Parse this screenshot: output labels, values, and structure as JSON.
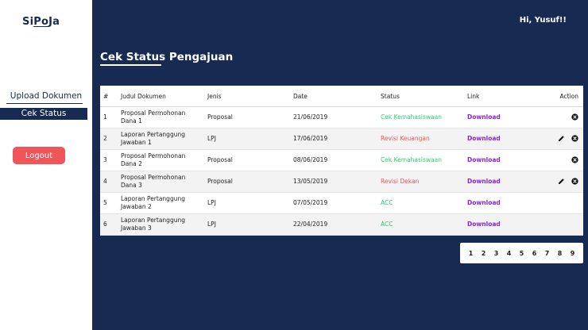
{
  "app": {
    "logo": "SiPoJa",
    "logo_underlined": "Po"
  },
  "sidebar": {
    "upload_label": "Upload Dokumen",
    "status_label": "Cek Status",
    "logout_label": "Logout"
  },
  "header": {
    "greeting": "Hi, Yusuf!!"
  },
  "main": {
    "title": "Cek Status Pengajuan"
  },
  "table": {
    "columns": [
      "#",
      "Judul Dokumen",
      "Jenis",
      "Date",
      "Status",
      "Link",
      "Action"
    ],
    "rows": [
      {
        "no": "1",
        "judul": "Proposal Permohonan Dana 1",
        "jenis": "Proposal",
        "date": "21/06/2019",
        "status": "Cek Kemahasiswaan",
        "link": "Download",
        "actions": [
          "delete"
        ]
      },
      {
        "no": "2",
        "judul": "Laporan Pertanggung Jawaban 1",
        "jenis": "LPJ",
        "date": "17/06/2019",
        "status": "Revisi Keuangan",
        "link": "Download",
        "actions": [
          "edit",
          "delete"
        ]
      },
      {
        "no": "3",
        "judul": "Proposal Permohonan Dana 2",
        "jenis": "Proposal",
        "date": "08/06/2019",
        "status": "Cek Kemahasiswaan",
        "link": "Download",
        "actions": [
          "delete"
        ]
      },
      {
        "no": "4",
        "judul": "Proposal Permohonan Dana 3",
        "jenis": "Proposal",
        "date": "13/05/2019",
        "status": "Revisi Dekan",
        "link": "Download",
        "actions": [
          "edit",
          "delete"
        ]
      },
      {
        "no": "5",
        "judul": "Laporan Pertanggung Jawaban 2",
        "jenis": "LPJ",
        "date": "07/05/2019",
        "status": "ACC",
        "link": "Download",
        "actions": []
      },
      {
        "no": "6",
        "judul": "Laporan Pertanggung Jawaban 3",
        "jenis": "LPJ",
        "date": "22/04/2019",
        "status": "ACC",
        "link": "Download",
        "actions": []
      }
    ]
  },
  "status_colors": {
    "Cek Kemahasiswaan": "#2ecc71",
    "Revisi Keuangan": "#f0555a",
    "Revisi Dekan": "#f0555a",
    "ACC": "#2ecc71"
  },
  "icons": {
    "edit": "pencil-icon",
    "delete": "close-circle-icon"
  },
  "pagination": [
    "1",
    "2",
    "3",
    "4",
    "5",
    "6",
    "7",
    "8",
    "9"
  ]
}
